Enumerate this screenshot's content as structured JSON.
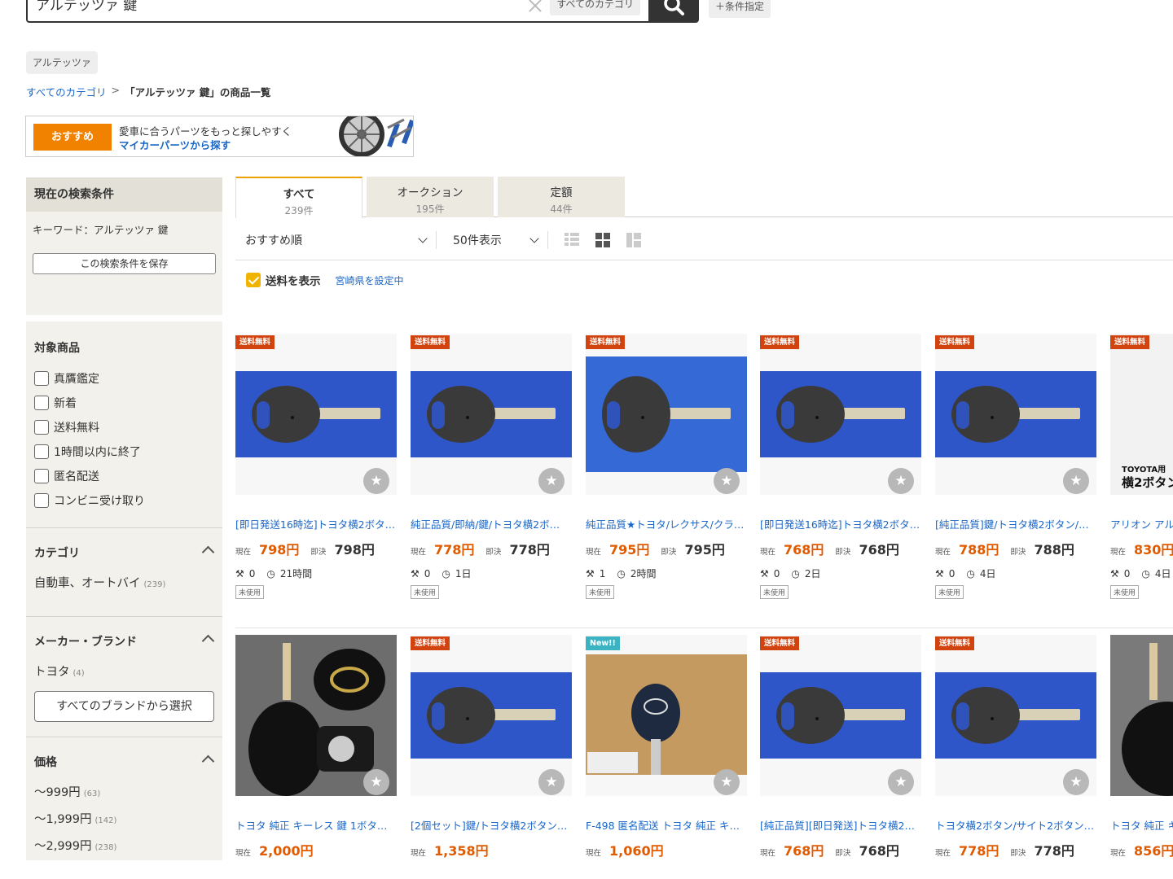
{
  "search": {
    "query": "アルテッツァ 鍵",
    "category_button": "すべてのカテゴリ",
    "conditions_button": "＋条件指定"
  },
  "chip": "アルテッツァ",
  "breadcrumb": {
    "all": "すべてのカテゴリ",
    "sep": ">",
    "current": "「アルテッツァ 鍵」の商品一覧"
  },
  "banner": {
    "badge": "おすすめ",
    "line1": "愛車に合うパーツをもっと探しやすく",
    "line2": "マイカーパーツから探す"
  },
  "sidebar": {
    "current_title": "現在の検索条件",
    "keyword": "キーワード：アルテッツァ 鍵",
    "save": "この検索条件を保存",
    "target_title": "対象商品",
    "targets": [
      "真贋鑑定",
      "新着",
      "送料無料",
      "1時間以内に終了",
      "匿名配送",
      "コンビニ受け取り"
    ],
    "category_title": "カテゴリ",
    "category_item": "自動車、オートバイ",
    "category_count": "(239)",
    "brand_title": "メーカー・ブランド",
    "brand_item": "トヨタ",
    "brand_count": "(4)",
    "brand_button": "すべてのブランドから選択",
    "price_title": "価格",
    "prices": [
      {
        "label": "～999円",
        "count": "(63)"
      },
      {
        "label": "～1,999円",
        "count": "(142)"
      },
      {
        "label": "～2,999円",
        "count": "(238)"
      }
    ]
  },
  "tabs": [
    {
      "label": "すべて",
      "count": "239件"
    },
    {
      "label": "オークション",
      "count": "195件"
    },
    {
      "label": "定額",
      "count": "44件"
    }
  ],
  "toolbar": {
    "sort": "おすすめ順",
    "per_page": "50件表示"
  },
  "shipping": {
    "label": "送料を表示",
    "pref": "宮崎県を設定中"
  },
  "labels": {
    "now": "現在",
    "buy": "即決",
    "free": "送料無料",
    "new": "New!!",
    "unused": "未使用",
    "toyota_a": "TOYOTA用",
    "toyota_b": "横2ボタン"
  },
  "products_row1": [
    {
      "title": "[即日発送16時迄]トヨタ横2ボタン…",
      "price": "798円",
      "buy": "798円",
      "bids": "0",
      "time": "21時間"
    },
    {
      "title": "純正品質/即納/鍵/トヨタ横2ボ…",
      "price": "778円",
      "buy": "778円",
      "bids": "0",
      "time": "1日"
    },
    {
      "title": "純正品質★トヨタ/レクサス/クラ…",
      "price": "795円",
      "buy": "795円",
      "bids": "1",
      "time": "2時間"
    },
    {
      "title": "[即日発送16時迄]トヨタ横2ボタ…",
      "price": "768円",
      "buy": "768円",
      "bids": "0",
      "time": "2日"
    },
    {
      "title": "[純正品質]鍵/トヨタ横2ボタン/…",
      "price": "788円",
      "buy": "788円",
      "bids": "0",
      "time": "4日"
    },
    {
      "title": "アリオン アル",
      "price": "830円",
      "buy": "",
      "bids": "0",
      "time": "4日"
    }
  ],
  "products_row2": [
    {
      "title": "トヨタ 純正 キーレス 鍵 1ボタ…",
      "price": "2,000円",
      "buy": ""
    },
    {
      "title": "[2個セット]鍵/トヨタ横2ボタン…",
      "price": "1,358円",
      "buy": ""
    },
    {
      "title": "F-498 匿名配送 トヨタ 純正 キ…",
      "price": "1,060円",
      "buy": ""
    },
    {
      "title": "[純正品質][即日発送]トヨタ横2…",
      "price": "768円",
      "buy": "768円"
    },
    {
      "title": "トヨタ横2ボタン/サイト2ボタン…",
      "price": "778円",
      "buy": "778円"
    },
    {
      "title": "トヨタ 純正 キ",
      "price": "856円",
      "buy": ""
    }
  ],
  "colors": {
    "accent": "#f08200",
    "link": "#1a66c8",
    "price": "#e05a00",
    "tag": "#d2440f"
  }
}
